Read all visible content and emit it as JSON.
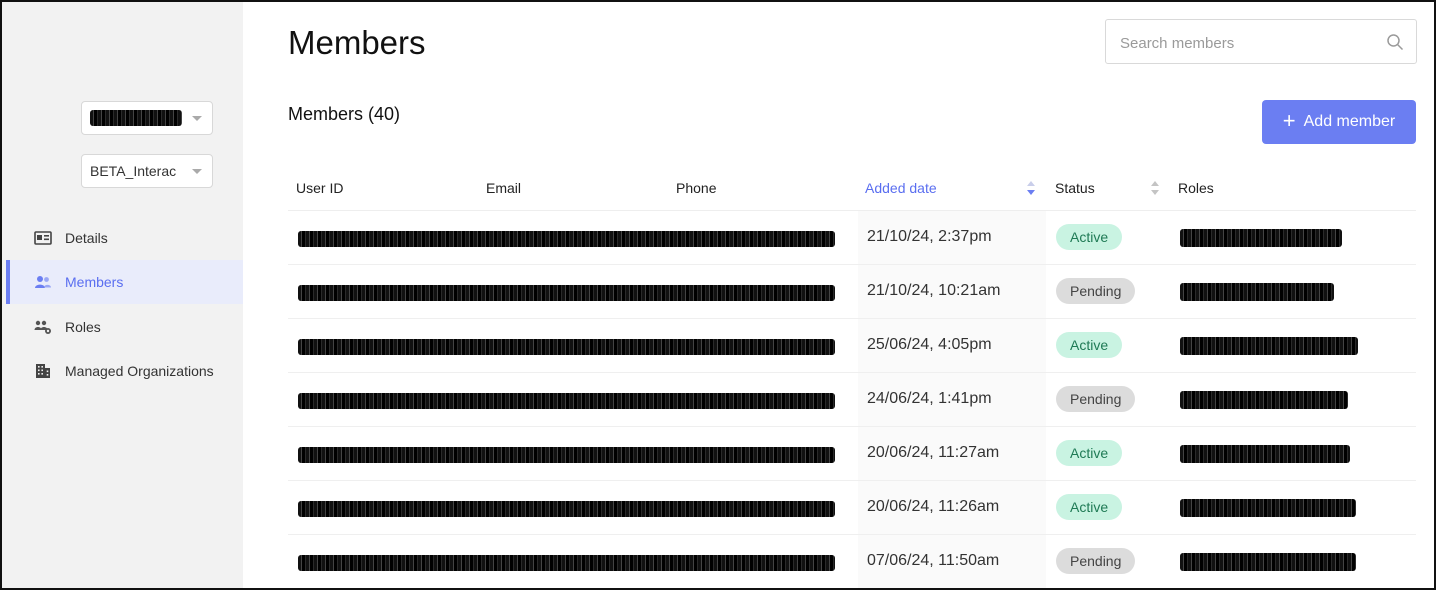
{
  "sidebar": {
    "org_selector": {
      "value": "[redacted]"
    },
    "project_selector": {
      "value": "BETA_Interac"
    },
    "items": [
      {
        "label": "Details",
        "icon": "id-card-icon",
        "active": false
      },
      {
        "label": "Members",
        "icon": "users-icon",
        "active": true
      },
      {
        "label": "Roles",
        "icon": "user-roles-icon",
        "active": false
      },
      {
        "label": "Managed Organizations",
        "icon": "building-icon",
        "active": false
      }
    ]
  },
  "main": {
    "title": "Members",
    "search": {
      "placeholder": "Search members"
    },
    "section_title": "Members (40)",
    "add_button": "Add member",
    "table": {
      "columns": [
        "User ID",
        "Email",
        "Phone",
        "Added date",
        "Status",
        "Roles"
      ],
      "sorted_column": "Added date",
      "rows": [
        {
          "added_date": "21/10/24, 2:37pm",
          "status": "Active"
        },
        {
          "added_date": "21/10/24, 10:21am",
          "status": "Pending"
        },
        {
          "added_date": "25/06/24, 4:05pm",
          "status": "Active"
        },
        {
          "added_date": "24/06/24, 1:41pm",
          "status": "Pending"
        },
        {
          "added_date": "20/06/24, 11:27am",
          "status": "Active"
        },
        {
          "added_date": "20/06/24, 11:26am",
          "status": "Active"
        },
        {
          "added_date": "07/06/24, 11:50am",
          "status": "Pending"
        }
      ]
    }
  },
  "colors": {
    "accent": "#6b7ef2",
    "active_badge": "#c9f3e2",
    "pending_badge": "#dcdcdc",
    "sidebar_bg": "#f2f2f2"
  }
}
